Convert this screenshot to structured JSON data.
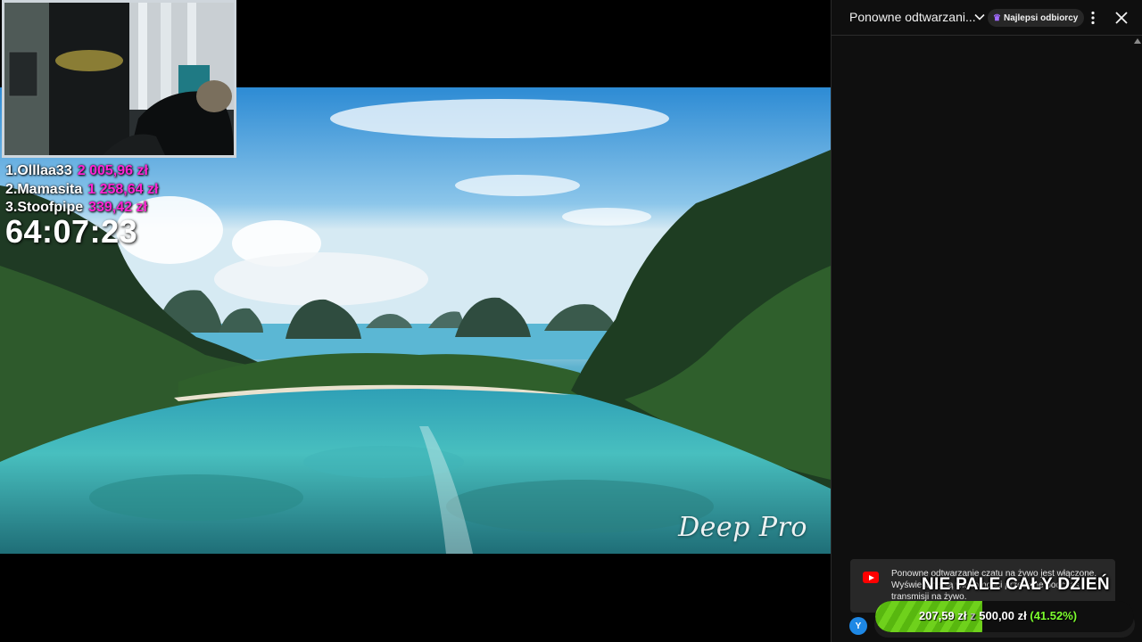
{
  "stream": {
    "watermark": "Deep Pro",
    "leaderboard": [
      {
        "rank": "1.",
        "name": "Olllaa33",
        "amount": "2 005,96 zł"
      },
      {
        "rank": "2.",
        "name": "Mamasita",
        "amount": "1 258,64 zł"
      },
      {
        "rank": "3.",
        "name": "Stoofpipe",
        "amount": "339,42 zł"
      }
    ],
    "timer": "64:07:23"
  },
  "goal": {
    "title": "NIE PALE CAŁY DZIEŃ",
    "current": "207,59 zł",
    "separator": "z",
    "target": "500,00 zł",
    "percent": "(41.52%)",
    "progress_fraction": 0.4152,
    "fill_color": "#6fd11c"
  },
  "chat": {
    "title": "Ponowne odtwarzani...",
    "filter_badge": "Najlepsi odbiorcy",
    "notice": "Ponowne odtwarzanie czatu na żywo jest włączone. Wyświetlane są wiadomości przesłane podczas transmisji na żywo.",
    "avatar_initial": "Y",
    "icons": {
      "dropdown": "chevron-down-icon",
      "crown": "crown-icon",
      "menu": "more-vert-icon",
      "close": "close-icon",
      "logo": "youtube-icon"
    }
  }
}
